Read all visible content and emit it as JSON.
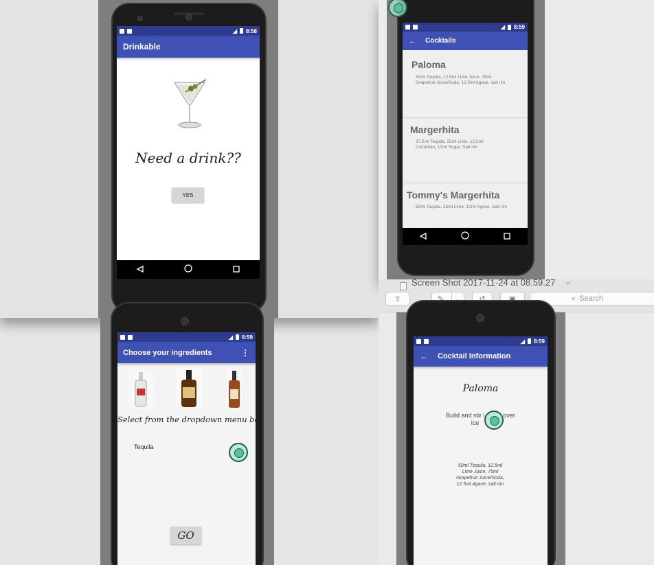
{
  "screen1": {
    "time": "8:58",
    "app_title": "Drinkable",
    "prompt": "Need a drink??",
    "yes_button": "YES"
  },
  "screen2": {
    "time": "8:59",
    "app_title": "Cocktails",
    "cocktails": [
      {
        "name": "Paloma",
        "ingredients": "50ml Tequila, 12.5ml Lime Juice, 75ml Grapefruit Juice/Soda, 12.5ml Agave, salt rim"
      },
      {
        "name": "Margerhita",
        "ingredients": "37.5ml Tequila, 25ml Lime, 12.5ml Cointreau, 10ml Sugar, Salt rim"
      },
      {
        "name": "Tommy's Margerhita",
        "ingredients": "50ml Tequila, 25ml Lime, 10ml Agave, Salt rim"
      }
    ]
  },
  "mac_window": {
    "title": "Screen Shot 2017-11-24 at 08.59.27",
    "search_placeholder": "Search"
  },
  "screen3": {
    "time": "8:59",
    "app_title": "Choose your ingredients",
    "instruction": "Select from the dropdown menu below.",
    "spinner_value": "Tequila",
    "go_button": "GO"
  },
  "screen4": {
    "time": "8:59",
    "app_title": "Cocktail Information",
    "cocktail_name": "Paloma",
    "method_before": "Build and stir i",
    "method_after": "over",
    "method_line2": "ice",
    "ingredients": "50ml Tequila, 12.5ml Lime Juice, 75ml Grapefruit Juice/Soda, 12.5ml Agave, salt rim"
  }
}
